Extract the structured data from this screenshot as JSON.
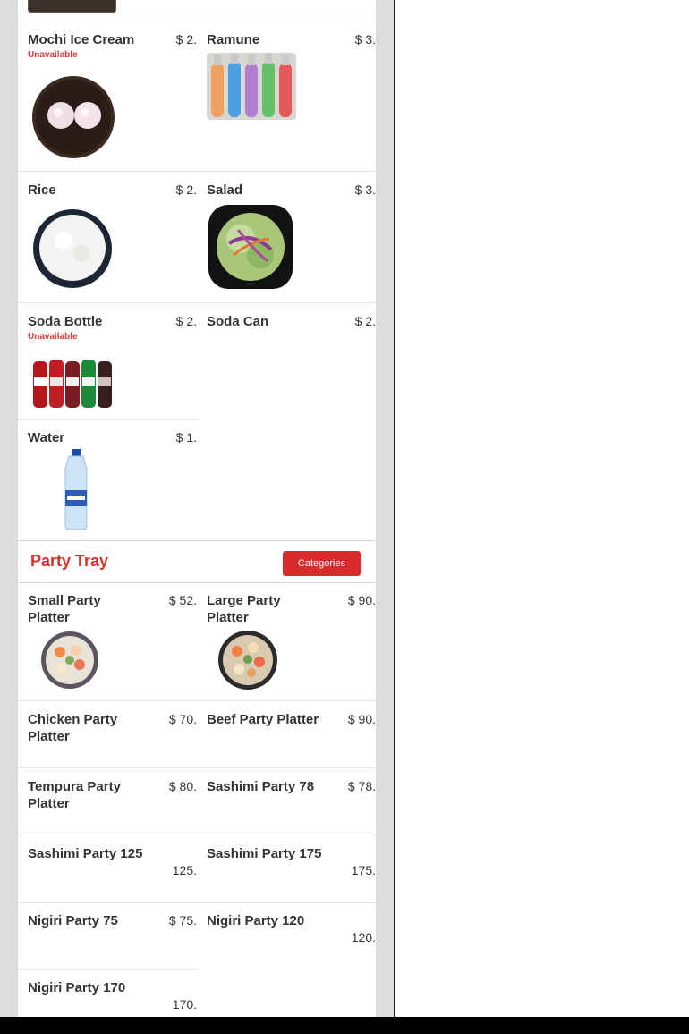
{
  "drinks_sides": {
    "items": [
      {
        "name": "Mochi Ice Cream",
        "price": "$ 2.",
        "status": "Unavailable",
        "icon": "mochi-image"
      },
      {
        "name": "Ramune",
        "price": "$ 3.",
        "icon": "ramune-bottles-image"
      },
      {
        "name": "Rice",
        "price": "$ 2.",
        "icon": "rice-bowl-image"
      },
      {
        "name": "Salad",
        "price": "$ 3.",
        "icon": "salad-bowl-image"
      },
      {
        "name": "Soda Bottle",
        "price": "$ 2.",
        "status": "Unavailable",
        "icon": "soda-bottles-image"
      },
      {
        "name": "Soda Can",
        "price": "$ 2."
      },
      {
        "name": "Water",
        "price": "$ 1.",
        "icon": "water-bottle-image"
      }
    ]
  },
  "party_tray": {
    "title": "Party Tray",
    "categories_button": "Categories",
    "items": [
      {
        "name": "Small Party Platter",
        "price": "$ 52.",
        "icon": "small-platter-image"
      },
      {
        "name": "Large Party Platter",
        "price": "$ 90.",
        "icon": "large-platter-image"
      },
      {
        "name": "Chicken Party Platter",
        "price": "$ 70."
      },
      {
        "name": "Beef Party Platter",
        "price": "$ 90."
      },
      {
        "name": "Tempura Party Platter",
        "price": "$ 80."
      },
      {
        "name": "Sashimi Party 78",
        "price": "$ 78."
      },
      {
        "name": "Sashimi Party 125",
        "price": "125."
      },
      {
        "name": "Sashimi Party 175",
        "price": "175."
      },
      {
        "name": "Nigiri Party 75",
        "price": "$ 75."
      },
      {
        "name": "Nigiri Party 120",
        "price": "120."
      },
      {
        "name": "Nigiri Party 170",
        "price": "170."
      }
    ]
  },
  "colors": {
    "accent": "#d9302a",
    "unavailable": "#e03a3a",
    "gutter": "#dcdcdc"
  }
}
